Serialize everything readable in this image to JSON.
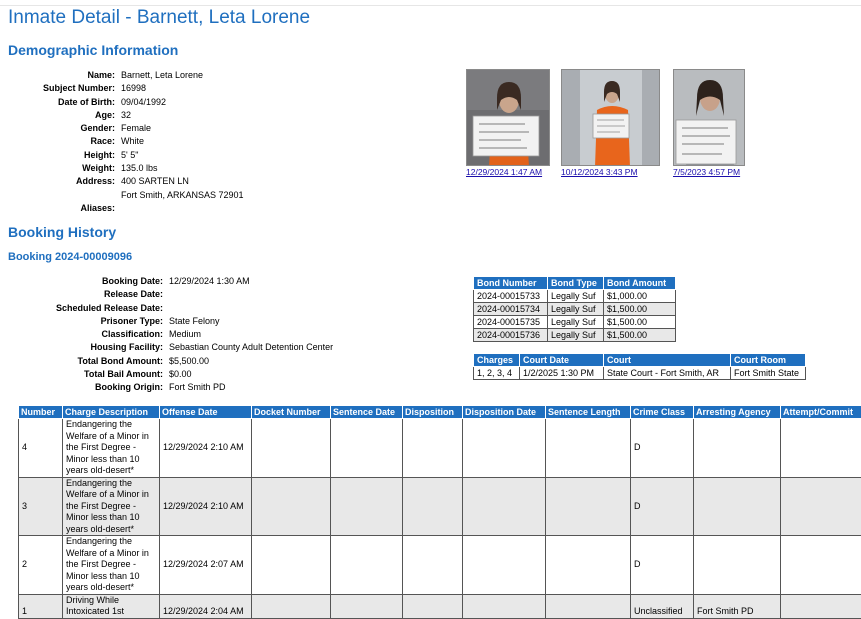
{
  "title": "Inmate Detail - Barnett, Leta Lorene",
  "demographic": {
    "heading": "Demographic Information",
    "fields": [
      {
        "label": "Name:",
        "value": "Barnett, Leta Lorene"
      },
      {
        "label": "Subject Number:",
        "value": "16998"
      },
      {
        "label": "Date of Birth:",
        "value": "09/04/1992"
      },
      {
        "label": "Age:",
        "value": "32"
      },
      {
        "label": "Gender:",
        "value": "Female"
      },
      {
        "label": "Race:",
        "value": "White"
      },
      {
        "label": "Height:",
        "value": "5' 5\""
      },
      {
        "label": "Weight:",
        "value": "135.0 lbs"
      },
      {
        "label": "Address:",
        "value": "400 SARTEN LN",
        "value2": "Fort Smith, ARKANSAS 72901"
      },
      {
        "label": "Aliases:",
        "value": ""
      }
    ],
    "photos": [
      {
        "caption": "12/29/2024 1:47 AM"
      },
      {
        "caption": "10/12/2024 3:43 PM"
      },
      {
        "caption": "7/5/2023 4:57 PM"
      }
    ]
  },
  "booking_history": {
    "heading": "Booking History",
    "booking_title": "Booking 2024-00009096",
    "fields": [
      {
        "label": "Booking Date:",
        "value": "12/29/2024 1:30 AM"
      },
      {
        "label": "Release Date:",
        "value": ""
      },
      {
        "label": "Scheduled Release Date:",
        "value": ""
      },
      {
        "label": "Prisoner Type:",
        "value": "State Felony"
      },
      {
        "label": "Classification:",
        "value": "Medium"
      },
      {
        "label": "Housing Facility:",
        "value": "Sebastian County Adult Detention Center"
      },
      {
        "label": "Total Bond Amount:",
        "value": "$5,500.00"
      },
      {
        "label": "Total Bail Amount:",
        "value": "$0.00"
      },
      {
        "label": "Booking Origin:",
        "value": "Fort Smith PD"
      }
    ],
    "bonds": {
      "headers": [
        "Bond Number",
        "Bond Type",
        "Bond Amount"
      ],
      "rows": [
        [
          "2024-00015733",
          "Legally Suf",
          "$1,000.00"
        ],
        [
          "2024-00015734",
          "Legally Suf",
          "$1,500.00"
        ],
        [
          "2024-00015735",
          "Legally Suf",
          "$1,500.00"
        ],
        [
          "2024-00015736",
          "Legally Suf",
          "$1,500.00"
        ]
      ]
    },
    "court": {
      "headers": [
        "Charges",
        "Court Date",
        "Court",
        "Court Room"
      ],
      "rows": [
        [
          "1, 2, 3, 4",
          "1/2/2025 1:30 PM",
          "State Court - Fort Smith, AR",
          "Fort Smith State"
        ]
      ]
    },
    "charges": {
      "headers": [
        "Number",
        "Charge Description",
        "Offense Date",
        "Docket Number",
        "Sentence Date",
        "Disposition",
        "Disposition Date",
        "Sentence Length",
        "Crime Class",
        "Arresting Agency",
        "Attempt/Commit"
      ],
      "rows": [
        {
          "number": "4",
          "description": "Endangering the Welfare of a Minor in the First Degree - Minor less than 10 years old-desert*",
          "offense_date": "12/29/2024 2:10 AM",
          "docket": "",
          "sentence_date": "",
          "disposition": "",
          "disposition_date": "",
          "sentence_length": "",
          "crime_class": "D",
          "agency": "",
          "attempt": ""
        },
        {
          "number": "3",
          "description": "Endangering the Welfare of a Minor in the First Degree - Minor less than 10 years old-desert*",
          "offense_date": "12/29/2024 2:10 AM",
          "docket": "",
          "sentence_date": "",
          "disposition": "",
          "disposition_date": "",
          "sentence_length": "",
          "crime_class": "D",
          "agency": "",
          "attempt": ""
        },
        {
          "number": "2",
          "description": "Endangering the Welfare of a Minor in the First Degree - Minor less than 10 years old-desert*",
          "offense_date": "12/29/2024 2:07 AM",
          "docket": "",
          "sentence_date": "",
          "disposition": "",
          "disposition_date": "",
          "sentence_length": "",
          "crime_class": "D",
          "agency": "",
          "attempt": ""
        },
        {
          "number": "1",
          "description": "Driving While Intoxicated 1st",
          "offense_date": "12/29/2024 2:04 AM",
          "docket": "",
          "sentence_date": "",
          "disposition": "",
          "disposition_date": "",
          "sentence_length": "",
          "crime_class": "Unclassified",
          "agency": "Fort Smith PD",
          "attempt": ""
        }
      ]
    }
  },
  "colors": {
    "accent": "#1f6fbf",
    "link": "#1a0dab",
    "row_alt": "#e8e8e8"
  }
}
